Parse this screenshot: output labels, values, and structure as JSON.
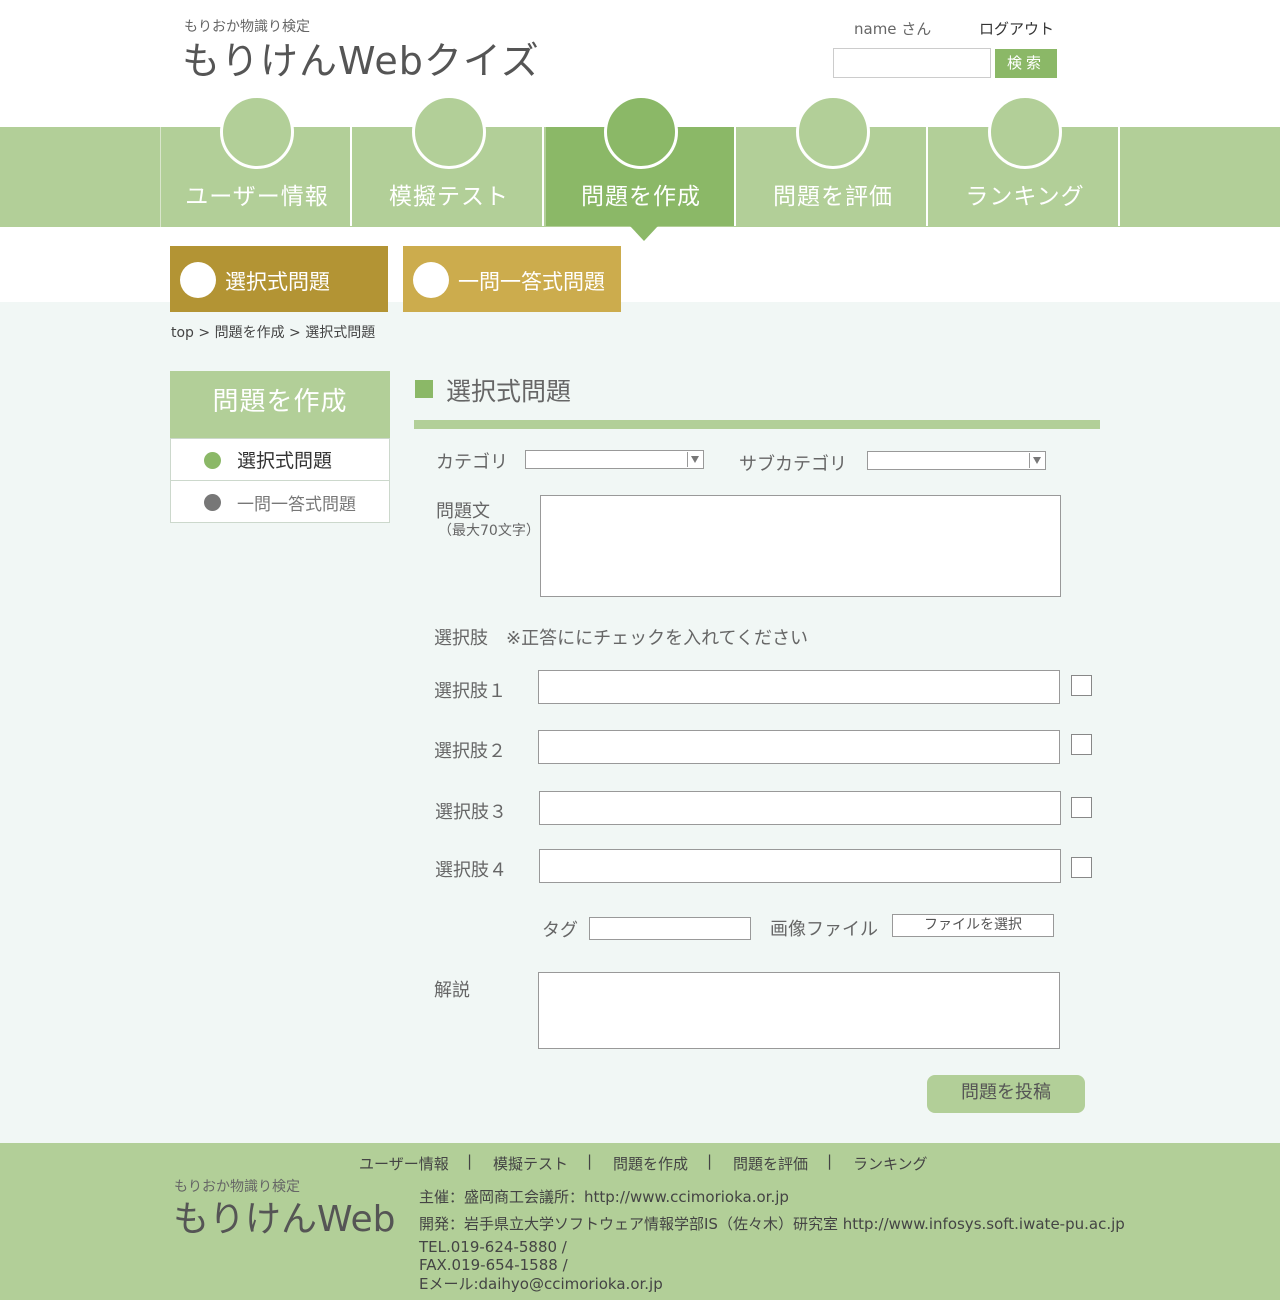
{
  "header": {
    "sub_title": "もりおか物識り検定",
    "title": "もりけんWebクイズ",
    "username": "name さん",
    "logout": "ログアウト",
    "search_placeholder": "",
    "search_button": "検索"
  },
  "nav": {
    "items": [
      {
        "label": "ユーザー情報"
      },
      {
        "label": "模擬テスト"
      },
      {
        "label": "問題を作成"
      },
      {
        "label": "問題を評価"
      },
      {
        "label": "ランキング"
      }
    ],
    "active_index": 2
  },
  "subtabs": [
    {
      "label": "選択式問題"
    },
    {
      "label": "一問一答式問題"
    }
  ],
  "breadcrumb": "top > 問題を作成 > 選択式問題",
  "side_menu": {
    "heading": "問題を作成",
    "items": [
      {
        "label": "選択式問題"
      },
      {
        "label": "一問一答式問題"
      }
    ]
  },
  "form": {
    "section_title": "選択式問題",
    "category_label": "カテゴリ",
    "category_value": "",
    "subcategory_label": "サブカテゴリ",
    "subcategory_value": "",
    "question_label": "問題文",
    "question_note": "（最大70文字）",
    "question_value": "",
    "choices_label": "選択肢　※正答ににチェックを入れてください",
    "choices": [
      {
        "label": "選択肢１",
        "value": "",
        "checked": false
      },
      {
        "label": "選択肢２",
        "value": "",
        "checked": false
      },
      {
        "label": "選択肢３",
        "value": "",
        "checked": false
      },
      {
        "label": "選択肢４",
        "value": "",
        "checked": false
      }
    ],
    "tag_label": "タグ",
    "tag_value": "",
    "image_label": "画像ファイル",
    "file_button": "ファイルを選択",
    "explanation_label": "解説",
    "explanation_value": "",
    "submit": "問題を投稿"
  },
  "footer": {
    "nav": [
      "ユーザー情報",
      "模擬テスト",
      "問題を作成",
      "問題を評価",
      "ランキング"
    ],
    "separator": "|",
    "sub_title": "もりおか物識り検定",
    "title": "もりけんWeb",
    "sponsor": "主催：盛岡商工会議所：http://www.ccimorioka.or.jp",
    "developer": "開発：岩手県立大学ソフトウェア情報学部IS（佐々木）研究室  http://www.infosys.soft.iwate-pu.ac.jp",
    "tel": "TEL.019-624-5880 /",
    "fax": "FAX.019-654-1588 /",
    "email": "Eメール:daihyo@ccimorioka.or.jp"
  },
  "colors": {
    "nav_green": "#b2cf98",
    "active_green": "#8bb867",
    "subtab_dark_gold": "#b39434",
    "subtab_gold": "#ccac4d",
    "content_bg": "#f1f7f5"
  }
}
